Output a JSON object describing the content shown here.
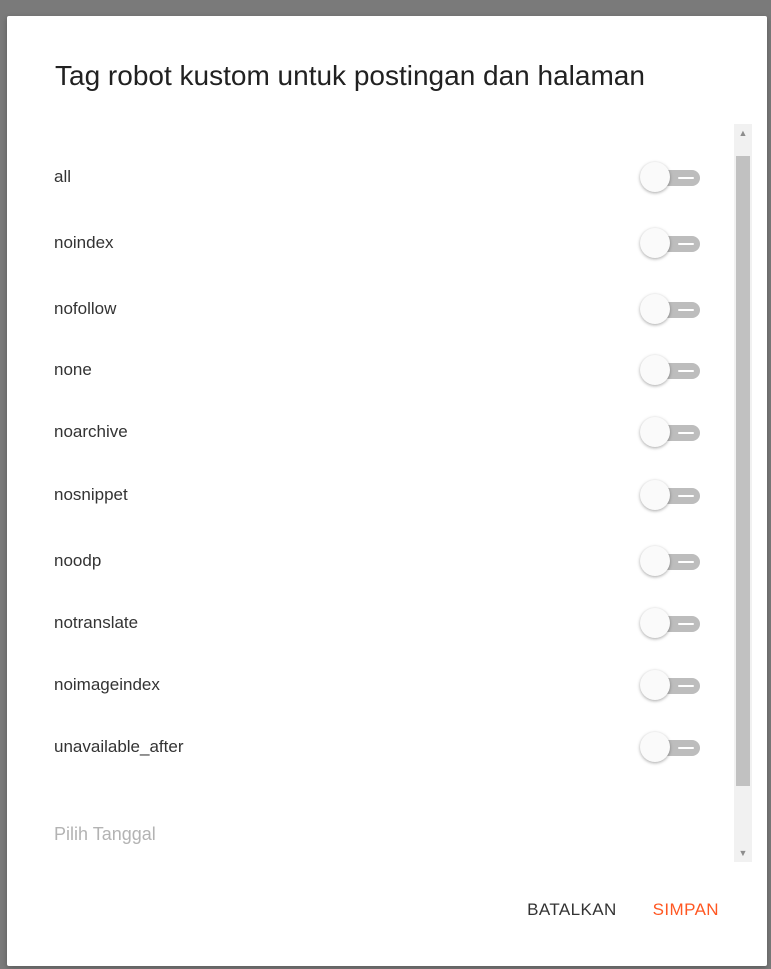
{
  "dialog": {
    "title": "Tag robot kustom untuk postingan dan halaman",
    "items": [
      {
        "label": "all",
        "enabled": false
      },
      {
        "label": "noindex",
        "enabled": false
      },
      {
        "label": "nofollow",
        "enabled": false
      },
      {
        "label": "none",
        "enabled": false
      },
      {
        "label": "noarchive",
        "enabled": false
      },
      {
        "label": "nosnippet",
        "enabled": false
      },
      {
        "label": "noodp",
        "enabled": false
      },
      {
        "label": "notranslate",
        "enabled": false
      },
      {
        "label": "noimageindex",
        "enabled": false
      },
      {
        "label": "unavailable_after",
        "enabled": false
      }
    ],
    "date_placeholder": "Pilih Tanggal",
    "cancel_label": "BATALKAN",
    "save_label": "SIMPAN"
  },
  "colors": {
    "accent": "#ff5722",
    "toggle_off_track": "#bdbdbd",
    "toggle_off_knob": "#fafafa"
  },
  "icons": {
    "scroll_up": "scroll-up-arrow-icon",
    "scroll_down": "scroll-down-arrow-icon"
  }
}
